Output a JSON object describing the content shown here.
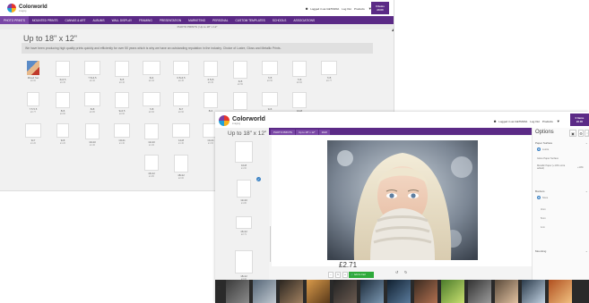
{
  "brand": {
    "name": "Colorworld",
    "sub": "imaging"
  },
  "header": {
    "login": "Logged in as GETM20A",
    "logout": "Log Out",
    "products": "Products",
    "cart_line1": "0 Items",
    "cart_line2": "£0.00"
  },
  "nav": [
    "PHOTO PRINTS",
    "MOUNTED PRINTS",
    "CANVAS & ART",
    "ALBUMS",
    "WALL DISPLAY",
    "FRAMING",
    "PRESENTATION",
    "MARKETING",
    "PERSONAL",
    "CUSTOM TEMPLATES",
    "SCHOOLS",
    "ASSOCIATIONS"
  ],
  "crumb": "PHOTO PRINTS  |  Up to 18\" x 12\"",
  "page": {
    "title": "Up to 18\" x 12\"",
    "desc": "We have been producing high quality prints quickly and efficiently for over 50 years which is why we have an outstanding reputation in the industry. Choice of Lustre, Gloss and Metallic Prints."
  },
  "tiles": [
    {
      "name": "Mixed Set",
      "price": "£0.00"
    },
    {
      "name": "6x4.5",
      "price": "£0.35"
    },
    {
      "name": "7.5x4.5",
      "price": "£0.40"
    },
    {
      "name": "5x5",
      "price": "£0.40"
    },
    {
      "name": "6x4",
      "price": "£0.40"
    },
    {
      "name": "6.5x4.5",
      "price": "£0.45"
    },
    {
      "name": "6.5x5",
      "price": "£0.45"
    },
    {
      "name": "6x5",
      "price": "£0.50"
    },
    {
      "name": "7x5",
      "price": "£0.50"
    },
    {
      "name": "7x6",
      "price": "£0.60"
    },
    {
      "name": "7x5",
      "price": "£0.77"
    },
    {
      "name": "7.5 5.5",
      "price": "£0.77"
    },
    {
      "name": "8x6",
      "price": "£0.80"
    },
    {
      "name": "8x8",
      "price": "£0.80"
    },
    {
      "name": "9x4.5",
      "price": "£0.90"
    },
    {
      "name": "7x8",
      "price": "£0.90"
    },
    {
      "name": "8x7",
      "price": "£0.90"
    },
    {
      "name": "8x4",
      "price": ""
    },
    {
      "name": "8x6",
      "price": ""
    },
    {
      "name": "9x6",
      "price": ""
    },
    {
      "name": "10x8",
      "price": "£1.60"
    },
    {
      "name": "9x7",
      "price": "£1.20"
    },
    {
      "name": "9x8",
      "price": "£1.20"
    },
    {
      "name": "10x10",
      "price": "£1.40"
    },
    {
      "name": "10x11",
      "price": "£1.40"
    },
    {
      "name": "12x10",
      "price": "£1.40"
    },
    {
      "name": "12x8",
      "price": "£1.40"
    },
    {
      "name": "14x11",
      "price": "£1.60"
    },
    {
      "name": "16x12",
      "price": "£1.80"
    },
    {
      "name": "18x12",
      "price": "£2.00"
    }
  ],
  "editor": {
    "title": "Up to 18\" x 12\"",
    "crumbs": [
      "PHOTO PRINTS",
      "Up to 18\" x 12\"",
      "10x8"
    ],
    "side_tiles": [
      {
        "name": "10x8",
        "price": "£1.60"
      },
      {
        "name": "12x10",
        "price": "£1.80"
      },
      {
        "name": "16x12",
        "price": "£2.71"
      },
      {
        "name": "18x12",
        "price": "£3.00"
      }
    ],
    "options_title": "Options",
    "paper_surface": "Paper Surface",
    "paper_opts": [
      "Lustre",
      "Gloss Paper Surface",
      "Metallic Paper (+10% extra added)"
    ],
    "paper_extra": "+10%",
    "borders": "Borders",
    "border_opts": [
      "None",
      "3mm",
      "5mm",
      "1cm"
    ],
    "mounting": "Mounting",
    "price": "£2.71",
    "qty": "1",
    "add_to_cart": "Add to Cart",
    "qty_minus": "−",
    "qty_plus": "+"
  },
  "colors": {
    "brand_purple": "#5b2a86",
    "add_green": "#2eaa3a",
    "accent_blue": "#3b82c4"
  }
}
